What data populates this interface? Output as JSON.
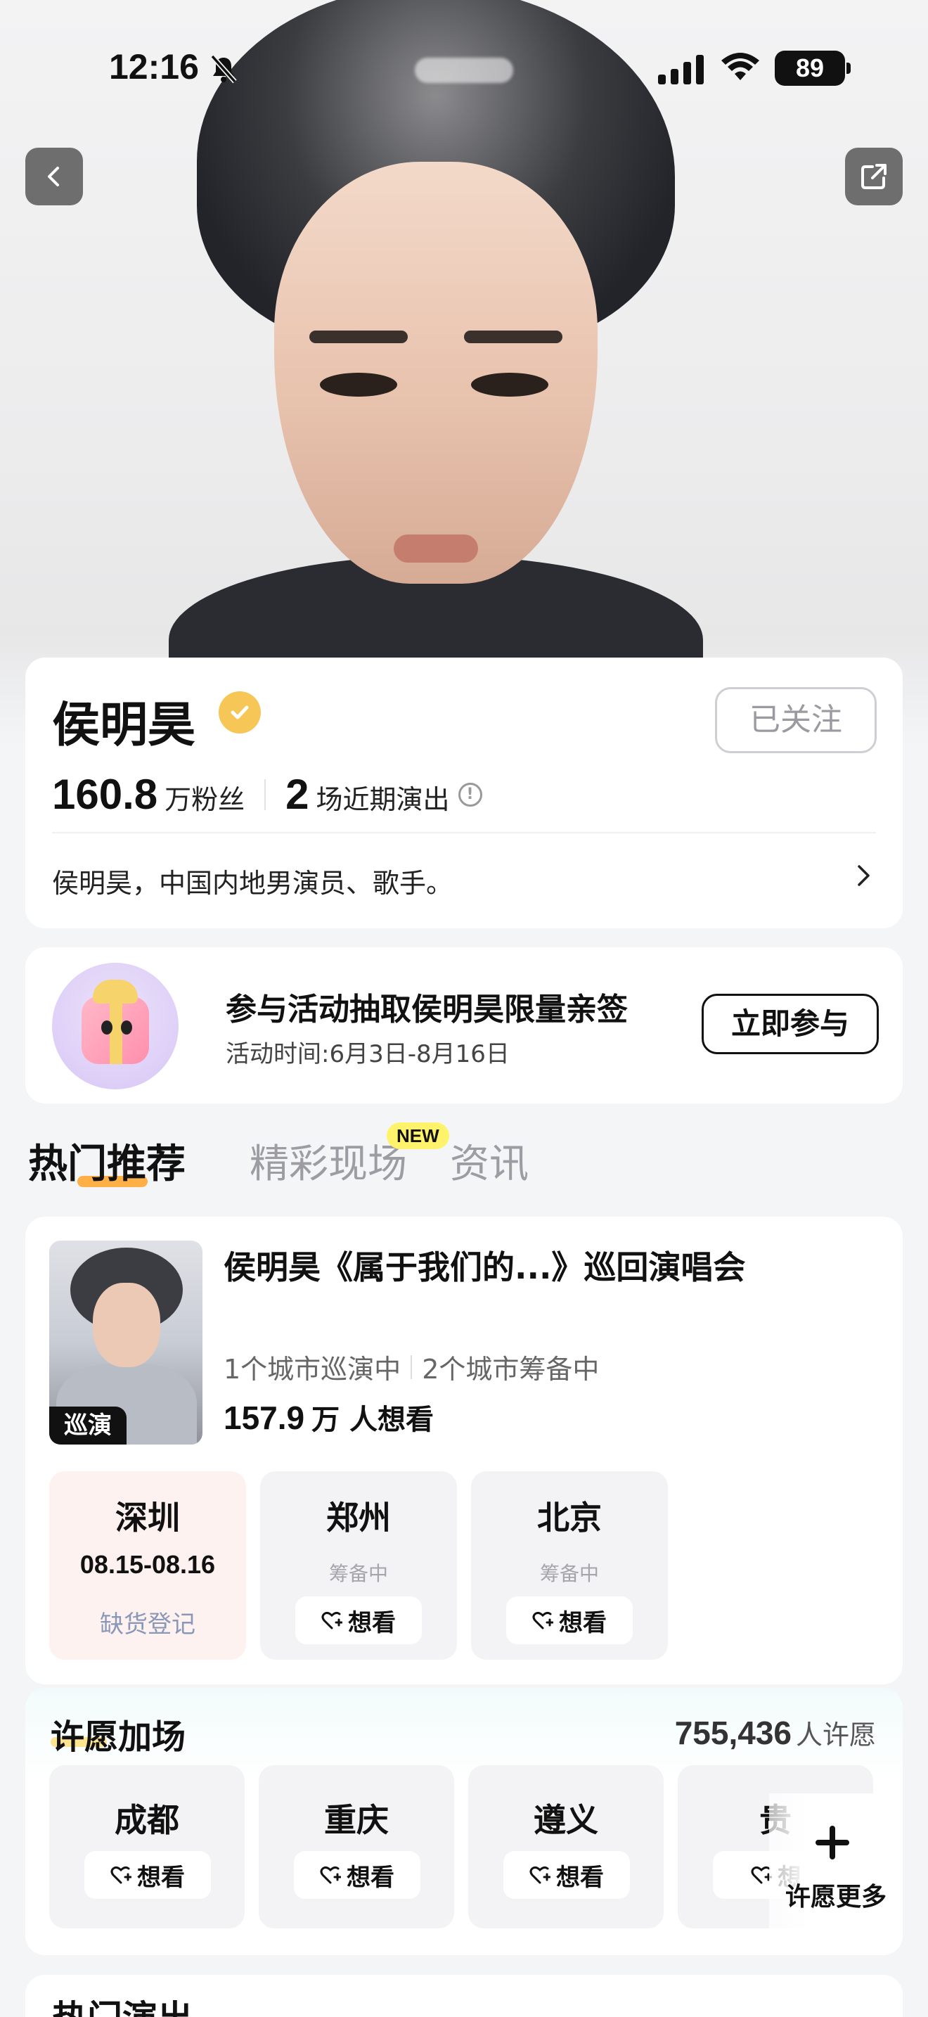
{
  "status_bar": {
    "time": "12:16",
    "battery": "89"
  },
  "artist": {
    "name": "侯明昊",
    "follow_label": "已关注",
    "fans_num": "160.8",
    "fans_label": "万粉丝",
    "shows_num": "2",
    "shows_label": "场近期演出",
    "bio": "侯明昊，中国内地男演员、歌手。"
  },
  "activity": {
    "title": "参与活动抽取侯明昊限量亲签",
    "time": "活动时间:6月3日-8月16日",
    "button": "立即参与"
  },
  "tabs": [
    {
      "label": "热门推荐"
    },
    {
      "label": "精彩现场"
    },
    {
      "label": "资讯"
    }
  ],
  "new_badge": "NEW",
  "concert": {
    "poster_tag": "巡演",
    "title": "侯明昊《属于我们的...》巡回演唱会",
    "touring": "1个城市巡演中",
    "preparing": "2个城市筹备中",
    "want_num": "157.9",
    "want_label": "万 人想看",
    "cities": [
      {
        "name": "深圳",
        "date": "08.15-08.16",
        "status": "缺货登记"
      },
      {
        "name": "郑州",
        "status": "筹备中",
        "button": "想看"
      },
      {
        "name": "北京",
        "status": "筹备中",
        "button": "想看"
      }
    ]
  },
  "wish": {
    "title": "许愿加场",
    "count": "755,436",
    "count_label": "人许愿",
    "cities": [
      {
        "name": "成都",
        "button": "想看"
      },
      {
        "name": "重庆",
        "button": "想看"
      },
      {
        "name": "遵义",
        "button": "想看"
      },
      {
        "name": "贵",
        "button": "想"
      }
    ],
    "more_label": "许愿更多"
  },
  "hot_section": {
    "title": "热门演出"
  },
  "colors": {
    "accent_orange": "#ffa933",
    "verified_yellow": "#f6c656",
    "new_badge": "#fff36b"
  }
}
